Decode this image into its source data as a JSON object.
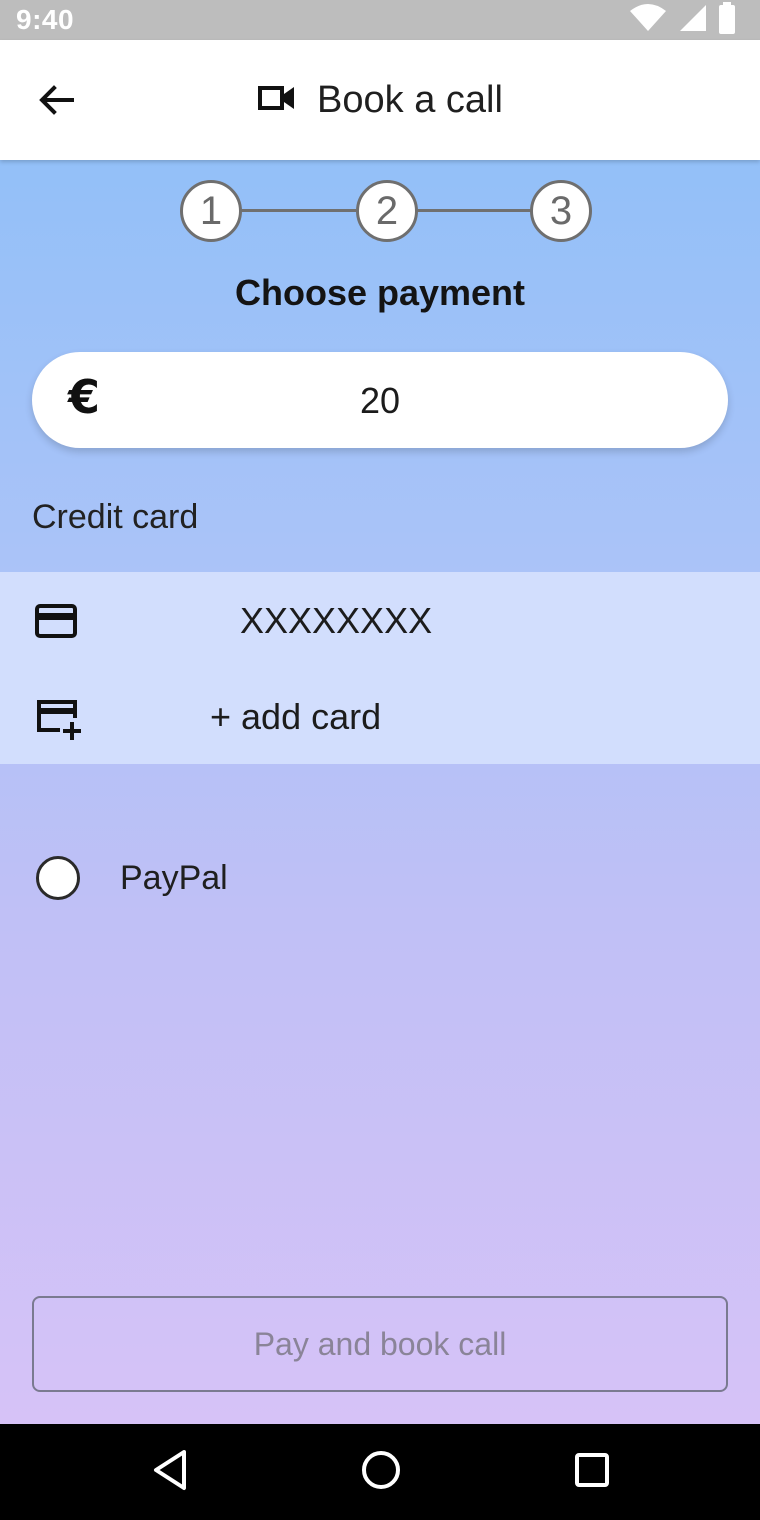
{
  "status_bar": {
    "time": "9:40",
    "icons": [
      "wifi-icon",
      "signal-icon",
      "battery-icon"
    ]
  },
  "app_bar": {
    "title": "Book a call",
    "back_icon": "arrow-back-icon",
    "title_icon": "video-camera-icon"
  },
  "stepper": {
    "steps": [
      "1",
      "2",
      "3"
    ]
  },
  "payment": {
    "title": "Choose payment",
    "currency_icon": "euro-icon",
    "currency_symbol": "€",
    "amount": "20",
    "credit_card_label": "Credit card",
    "cards": [
      {
        "icon": "credit-card-icon",
        "label": "XXXXXXXX"
      },
      {
        "icon": "add-card-icon",
        "label": "+ add card"
      }
    ],
    "paypal_label": "PayPal",
    "paypal_selected": false
  },
  "actions": {
    "pay_button_label": "Pay and book call"
  },
  "nav_bar": {
    "buttons": [
      "back-triangle-icon",
      "home-circle-icon",
      "recents-square-icon"
    ]
  },
  "colors": {
    "gradient_top": "#93c0f8",
    "gradient_bottom": "#d6c2f7",
    "card_list_bg": "#d2defd",
    "status_bar_bg": "#bdbdbd"
  }
}
